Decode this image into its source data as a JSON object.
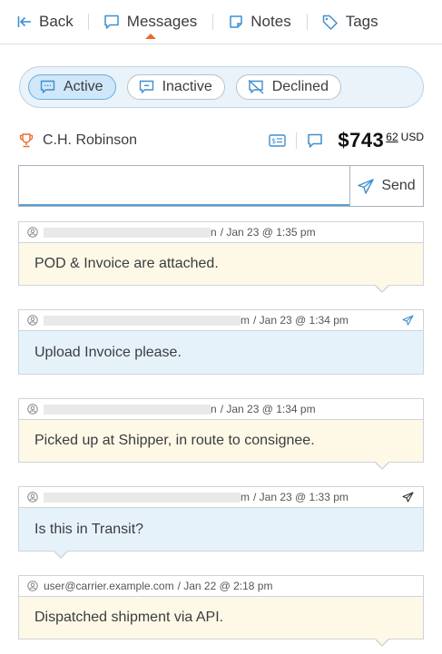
{
  "nav": {
    "back_label": "Back",
    "messages_label": "Messages",
    "notes_label": "Notes",
    "tags_label": "Tags",
    "active_tab": "Messages"
  },
  "filters": {
    "active_label": "Active",
    "inactive_label": "Inactive",
    "declined_label": "Declined",
    "selected": "Active"
  },
  "carrier": {
    "name": "C.H. Robinson",
    "price_main": "$743",
    "price_cents": "62",
    "currency": "USD"
  },
  "compose": {
    "input_value": "",
    "send_label": "Send"
  },
  "messages": [
    {
      "sender_tail": "n",
      "meta": "/  Jan 23 @ 1:35 pm",
      "body": "POD & Invoice are attached.",
      "direction": "incoming"
    },
    {
      "sender_tail": "m",
      "meta": "/  Jan 23 @ 1:34 pm",
      "body": "Upload Invoice please.",
      "direction": "outgoing"
    },
    {
      "sender_tail": "n",
      "meta": "/  Jan 23 @ 1:34 pm",
      "body": "Picked up at Shipper, in route to consignee.",
      "direction": "incoming"
    },
    {
      "sender_tail": "m",
      "meta": "/  Jan 23 @ 1:33 pm",
      "body": "Is this in Transit?",
      "direction": "outgoing"
    },
    {
      "sender": "user@carrier.example.com",
      "meta": "/  Jan 22 @ 2:18 pm",
      "body": "Dispatched shipment via API.",
      "direction": "incoming"
    }
  ],
  "colors": {
    "accent": "#ea6b2d",
    "link_blue": "#3f8fcf",
    "incoming_bg": "#fdf9e6",
    "outgoing_bg": "#e6f2fa",
    "filter_bg": "#eaf3f9"
  }
}
